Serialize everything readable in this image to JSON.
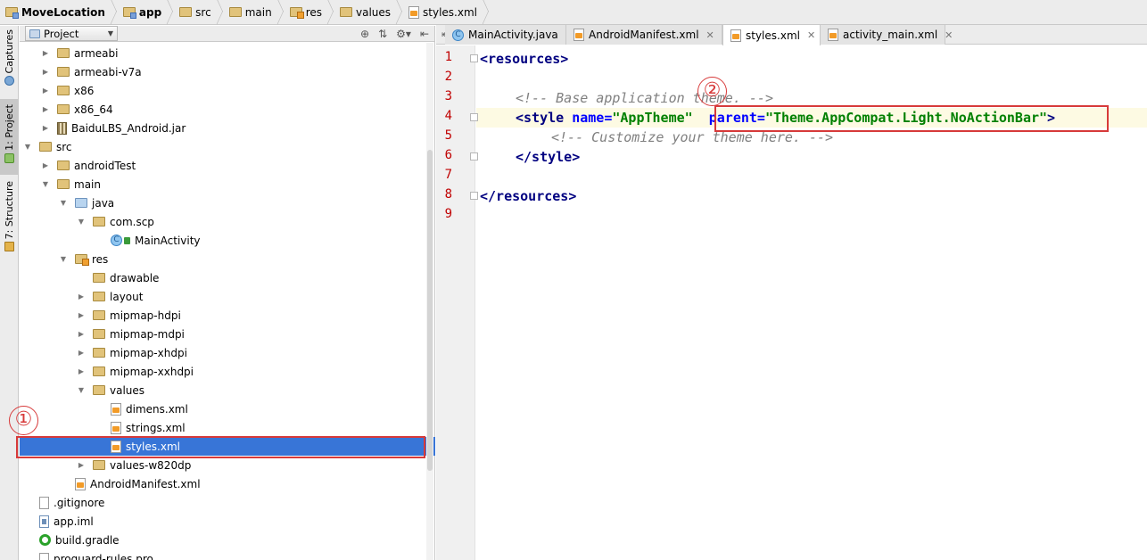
{
  "breadcrumb": [
    {
      "label": "MoveLocation",
      "icon": "module-folder-icon",
      "bold": true
    },
    {
      "label": "app",
      "icon": "module-folder-icon",
      "bold": true
    },
    {
      "label": "src",
      "icon": "folder-icon",
      "bold": false
    },
    {
      "label": "main",
      "icon": "folder-icon",
      "bold": false
    },
    {
      "label": "res",
      "icon": "res-folder-icon",
      "bold": false
    },
    {
      "label": "values",
      "icon": "folder-icon",
      "bold": false
    },
    {
      "label": "styles.xml",
      "icon": "xml-file-icon",
      "bold": false
    }
  ],
  "toolwindows": {
    "captures": "Captures",
    "project": "1: Project",
    "structure": "7: Structure"
  },
  "project_panel": {
    "view_label": "Project",
    "tree": [
      {
        "label": "armeabi",
        "depth": 3,
        "twisty": "collapsed",
        "icon": "folder"
      },
      {
        "label": "armeabi-v7a",
        "depth": 3,
        "twisty": "collapsed",
        "icon": "folder"
      },
      {
        "label": "x86",
        "depth": 3,
        "twisty": "collapsed",
        "icon": "folder"
      },
      {
        "label": "x86_64",
        "depth": 3,
        "twisty": "collapsed",
        "icon": "folder"
      },
      {
        "label": "BaiduLBS_Android.jar",
        "depth": 3,
        "twisty": "collapsed",
        "icon": "jar"
      },
      {
        "label": "src",
        "depth": 2,
        "twisty": "expanded",
        "icon": "folder"
      },
      {
        "label": "androidTest",
        "depth": 3,
        "twisty": "collapsed",
        "icon": "folder"
      },
      {
        "label": "main",
        "depth": 3,
        "twisty": "expanded",
        "icon": "folder"
      },
      {
        "label": "java",
        "depth": 4,
        "twisty": "expanded",
        "icon": "folder-blue"
      },
      {
        "label": "com.scp",
        "depth": 5,
        "twisty": "expanded",
        "icon": "folder"
      },
      {
        "label": "MainActivity",
        "depth": 6,
        "twisty": "none",
        "icon": "class"
      },
      {
        "label": "res",
        "depth": 4,
        "twisty": "expanded",
        "icon": "folder-res"
      },
      {
        "label": "drawable",
        "depth": 5,
        "twisty": "none",
        "icon": "folder"
      },
      {
        "label": "layout",
        "depth": 5,
        "twisty": "collapsed",
        "icon": "folder"
      },
      {
        "label": "mipmap-hdpi",
        "depth": 5,
        "twisty": "collapsed",
        "icon": "folder"
      },
      {
        "label": "mipmap-mdpi",
        "depth": 5,
        "twisty": "collapsed",
        "icon": "folder"
      },
      {
        "label": "mipmap-xhdpi",
        "depth": 5,
        "twisty": "collapsed",
        "icon": "folder"
      },
      {
        "label": "mipmap-xxhdpi",
        "depth": 5,
        "twisty": "collapsed",
        "icon": "folder"
      },
      {
        "label": "values",
        "depth": 5,
        "twisty": "expanded",
        "icon": "folder"
      },
      {
        "label": "dimens.xml",
        "depth": 6,
        "twisty": "none",
        "icon": "xml"
      },
      {
        "label": "strings.xml",
        "depth": 6,
        "twisty": "none",
        "icon": "xml"
      },
      {
        "label": "styles.xml",
        "depth": 6,
        "twisty": "none",
        "icon": "xml",
        "selected": true
      },
      {
        "label": "values-w820dp",
        "depth": 5,
        "twisty": "collapsed",
        "icon": "folder"
      },
      {
        "label": "AndroidManifest.xml",
        "depth": 4,
        "twisty": "none",
        "icon": "xml"
      },
      {
        "label": ".gitignore",
        "depth": 2,
        "twisty": "none",
        "icon": "file"
      },
      {
        "label": "app.iml",
        "depth": 2,
        "twisty": "none",
        "icon": "iml"
      },
      {
        "label": "build.gradle",
        "depth": 2,
        "twisty": "none",
        "icon": "gradle"
      },
      {
        "label": "proguard-rules.pro",
        "depth": 2,
        "twisty": "none",
        "icon": "file"
      }
    ]
  },
  "editor_tabs": [
    {
      "label": "MainActivity.java",
      "icon": "class",
      "active": false
    },
    {
      "label": "AndroidManifest.xml",
      "icon": "xml",
      "active": false
    },
    {
      "label": "styles.xml",
      "icon": "xml",
      "active": true
    },
    {
      "label": "activity_main.xml",
      "icon": "xml",
      "active": false
    }
  ],
  "editor": {
    "line_numbers": [
      "1",
      "2",
      "3",
      "4",
      "5",
      "6",
      "7",
      "8",
      "9"
    ],
    "lines": {
      "l1_tag": "<resources>",
      "l3_comment": "<!-- Base application theme. -->",
      "l4_open": "<style ",
      "l4_attr1": "name=",
      "l4_val1": "\"AppTheme\"",
      "l4_attr2": "parent=",
      "l4_val2": "\"Theme.AppCompat.Light.NoActionBar\"",
      "l4_close": ">",
      "l5_comment": "<!-- Customize your theme here. -->",
      "l6_tag": "</style>",
      "l8_tag": "</resources>"
    }
  },
  "annotations": {
    "marker_1": "①",
    "marker_2": "②"
  },
  "colors": {
    "annotation_red": "#d73a3a",
    "selection_blue": "#3875d7",
    "line_number_red": "#c00000"
  }
}
